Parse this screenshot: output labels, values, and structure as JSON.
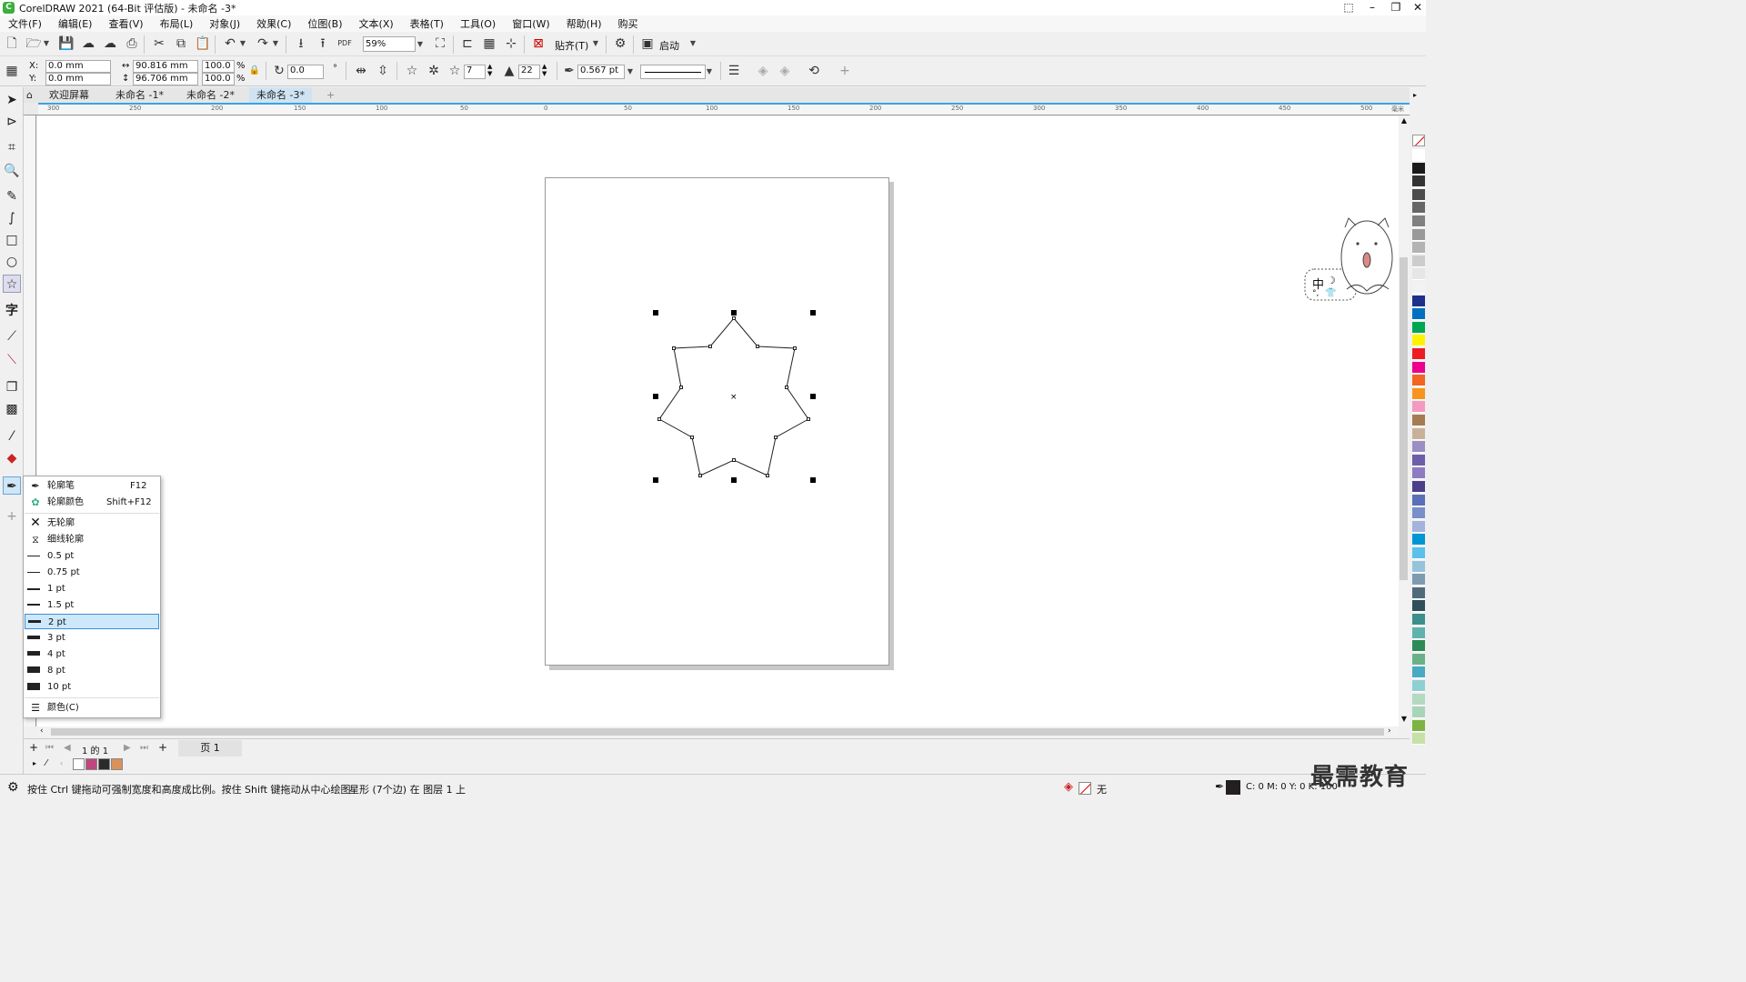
{
  "window": {
    "title": "CorelDRAW 2021 (64-Bit 评估版) - 未命名 -3*"
  },
  "menu": [
    "文件(F)",
    "编辑(E)",
    "查看(V)",
    "布局(L)",
    "对象(J)",
    "效果(C)",
    "位图(B)",
    "文本(X)",
    "表格(T)",
    "工具(O)",
    "窗口(W)",
    "帮助(H)",
    "购买"
  ],
  "toolbar": {
    "zoom": "59%",
    "snap_label": "贴齐(T)",
    "launch_label": "启动"
  },
  "props": {
    "x": "0.0 mm",
    "y": "0.0 mm",
    "x_label": "X:",
    "y_label": "Y:",
    "width": "90.816 mm",
    "height": "96.706 mm",
    "scale_w": "100.0",
    "scale_h": "100.0",
    "pct": "%",
    "rotation": "0.0",
    "points": "7",
    "sharpness": "22",
    "outline_width": "0.567 pt"
  },
  "tabs": {
    "welcome": "欢迎屏幕",
    "doc1": "未命名 -1*",
    "doc2": "未命名 -2*",
    "doc3": "未命名 -3*"
  },
  "ruler": {
    "h_ticks": [
      "300",
      "250",
      "200",
      "150",
      "100",
      "50",
      "0",
      "50",
      "100",
      "150",
      "200",
      "250",
      "300",
      "350",
      "400",
      "450",
      "500",
      "毫米"
    ]
  },
  "flyout": {
    "outline_pen": "轮廓笔",
    "outline_pen_key": "F12",
    "outline_color": "轮廓颜色",
    "outline_color_key": "Shift+F12",
    "no_outline": "无轮廓",
    "hairline": "细线轮廓",
    "widths": [
      "0.5 pt",
      "0.75 pt",
      "1 pt",
      "1.5 pt",
      "2 pt",
      "3 pt",
      "4 pt",
      "8 pt",
      "10 pt"
    ],
    "selected_width": "2 pt",
    "color": "颜色(C)"
  },
  "ime": {
    "label": "中"
  },
  "pagenav": {
    "page_of": "1 的 1",
    "page_tab": "页 1"
  },
  "status": {
    "hint": "按住 Ctrl 键拖动可强制宽度和高度成比例。按住 Shift 键拖动从中心绘图",
    "object_info": "星形 (7个边) 在 图层 1 上",
    "fill": "无",
    "outline_readout": "C: 0 M: 0 Y: 0 K: 100"
  },
  "watermark": "最需教育",
  "palette": [
    "#ffffff",
    "#1a1a1a",
    "#333333",
    "#4d4d4d",
    "#666666",
    "#808080",
    "#999999",
    "#b3b3b3",
    "#cccccc",
    "#e6e6e6",
    "#f2f2f2",
    "#1e2f8c",
    "#0070c0",
    "#00a651",
    "#fff200",
    "#ed1c24",
    "#ec008c",
    "#f26522",
    "#f7941d",
    "#f49ac1",
    "#a57c52",
    "#c7b299",
    "#9b8ec2",
    "#6c5fa8",
    "#8e7cc3",
    "#4b3f8a",
    "#5a6fb5",
    "#7a8fc9",
    "#a3b3dc",
    "#0096d6",
    "#5bc0eb",
    "#96c3dc",
    "#7e9bb0",
    "#4f6b7a",
    "#2f4f5a",
    "#3d8f8a",
    "#5fb3ad",
    "#2e8b57",
    "#6ab187",
    "#48a9c5",
    "#8fcfd1",
    "#b5d8c0",
    "#a8d5ba",
    "#7cb342",
    "#c5e1a5"
  ],
  "doc_palette": [
    "#ffffff",
    "#c0467f",
    "#2b2b2b",
    "#d9925a"
  ]
}
